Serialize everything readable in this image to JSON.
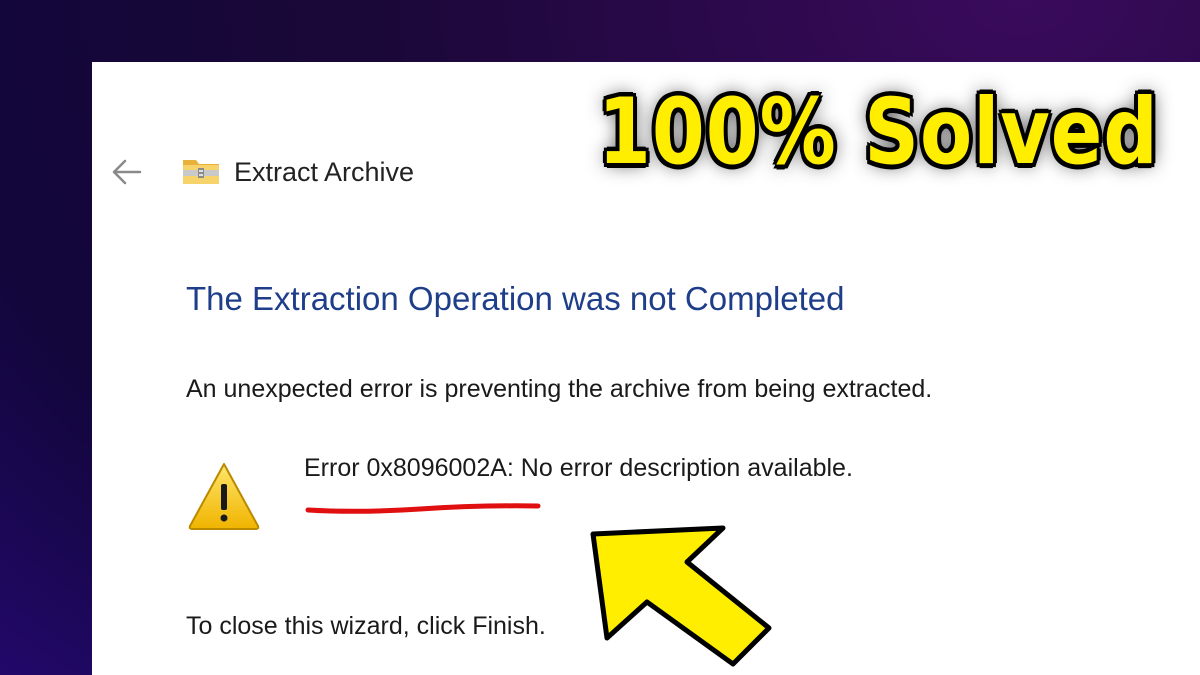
{
  "window": {
    "title": "Extract Archive",
    "back_icon": "back-arrow-icon",
    "folder_icon": "compressed-folder-icon"
  },
  "content": {
    "heading": "The Extraction Operation was not Completed",
    "message": "An unexpected error is preventing the archive from being extracted.",
    "error_text": "Error 0x8096002A: No error description available.",
    "warning_icon": "warning-icon",
    "close_hint": "To close this wizard, click Finish."
  },
  "overlay": {
    "banner": "100% Solved",
    "banner_color": "#ffee00",
    "underline_color": "#e01010",
    "arrow_color": "#ffee00"
  },
  "colors": {
    "heading": "#1e3e8a",
    "background": "#1a0838"
  }
}
